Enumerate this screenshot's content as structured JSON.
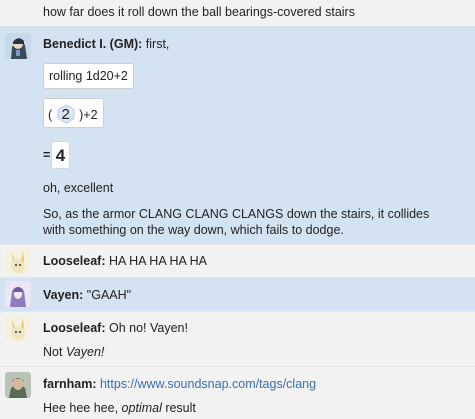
{
  "chat": {
    "top_line": "how far does it roll down the ball bearings-covered stairs",
    "gm_message": {
      "speaker": "Benedict I. (GM):",
      "intro": "first,",
      "roll_formula": "rolling 1d20+2",
      "roll_open": "(",
      "die_value": "2",
      "roll_close": ")+2",
      "equals": "=",
      "total": "4",
      "comment": "oh, excellent",
      "narration_line1": "So, as the armor CLANG CLANG CLANGS down the stairs, it collides",
      "narration_line2": "with something on the way down, which fails to dodge."
    },
    "looseleaf_1": {
      "speaker": "Looseleaf:",
      "text": "HA HA HA HA HA"
    },
    "vayen": {
      "speaker": "Vayen:",
      "text": "\"GAAH\""
    },
    "looseleaf_2": {
      "speaker": "Looseleaf:",
      "text": "Oh no! Vayen!",
      "followup_prefix": "Not ",
      "followup_emph": "Vayen!"
    },
    "farnham": {
      "speaker": "farnham:",
      "link": "https://www.soundsnap.com/tags/clang",
      "followup_prefix": "Hee hee hee, ",
      "followup_emph": "optimal",
      "followup_suffix": " result"
    }
  },
  "colors": {
    "gm_bg": "#d4e3f2",
    "link": "#3a6fb0"
  }
}
